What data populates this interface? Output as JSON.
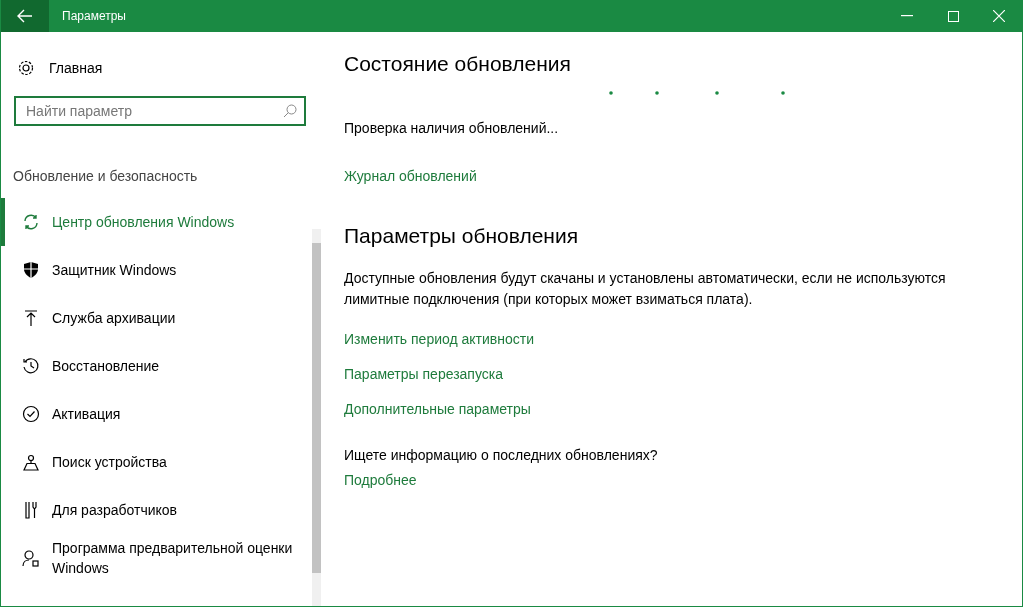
{
  "window": {
    "title": "Параметры"
  },
  "sidebar": {
    "home": "Главная",
    "search": {
      "placeholder": "Найти параметр"
    },
    "section": "Обновление и безопасность",
    "items": [
      {
        "label": "Центр обновления Windows",
        "selected": true
      },
      {
        "label": "Защитник Windows",
        "selected": false
      },
      {
        "label": "Служба архивации",
        "selected": false
      },
      {
        "label": "Восстановление",
        "selected": false
      },
      {
        "label": "Активация",
        "selected": false
      },
      {
        "label": "Поиск устройства",
        "selected": false
      },
      {
        "label": "Для разработчиков",
        "selected": false
      },
      {
        "label": "Программа предварительной оценки Windows",
        "selected": false
      }
    ]
  },
  "content": {
    "status_heading": "Состояние обновления",
    "status_text": "Проверка наличия обновлений...",
    "history_link": "Журнал обновлений",
    "settings_heading": "Параметры обновления",
    "settings_text": "Доступные обновления будут скачаны и установлены автоматически, если не используются лимитные подключения (при которых может взиматься плата).",
    "links": [
      "Изменить период активности",
      "Параметры перезапуска",
      "Дополнительные параметры"
    ],
    "info_question": "Ищете информацию о последних обновлениях?",
    "info_link": "Подробнее"
  }
}
